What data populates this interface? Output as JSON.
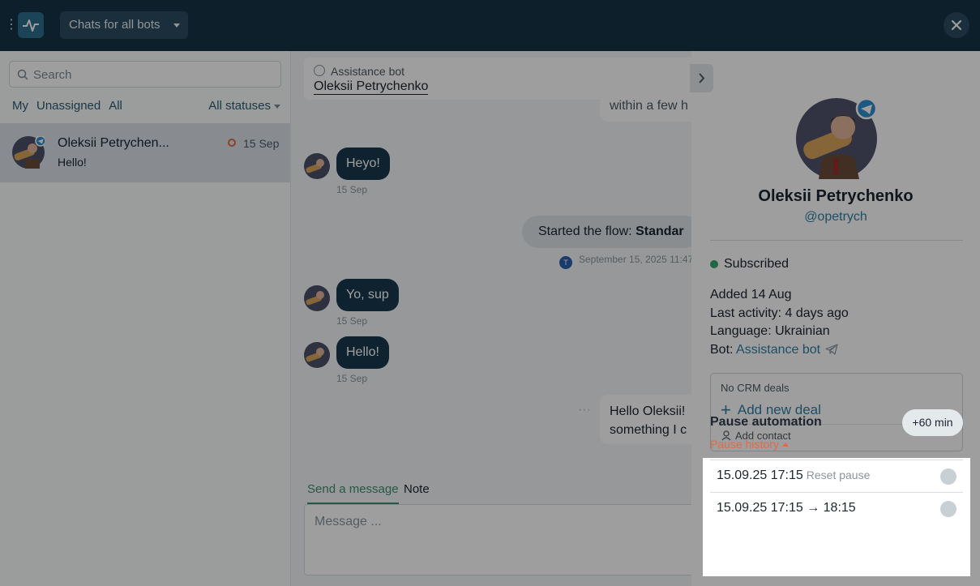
{
  "topbar": {
    "selector_label": "Chats for all bots"
  },
  "left": {
    "search_placeholder": "Search",
    "filters": [
      "My",
      "Unassigned",
      "All"
    ],
    "status_filter": "All statuses",
    "chats": [
      {
        "name": "Oleksii Petrychen...",
        "preview": "Hello!",
        "date": "15 Sep"
      }
    ]
  },
  "center": {
    "header": {
      "bot": "Assistance bot",
      "contact": "Oleksii Petrychenko"
    },
    "partial_text": "within a few h",
    "messages": [
      {
        "text": "Heyo!",
        "date": "15 Sep"
      },
      {
        "text": "Yo, sup",
        "date": "15 Sep"
      },
      {
        "text": "Hello!",
        "date": "15 Sep"
      }
    ],
    "flow": {
      "prefix": "Started the flow: ",
      "name": "Standar",
      "meta": "September 15, 2025 11:47"
    },
    "outgoing": {
      "line1": "Hello Oleksii!",
      "line2": "something I c"
    },
    "tabs": {
      "send": "Send a message",
      "note": "Note"
    },
    "composer_placeholder": "Message ..."
  },
  "profile": {
    "name": "Oleksii Petrychenko",
    "username": "@opetrych",
    "status": "Subscribed",
    "added": "Added 14 Aug",
    "last_activity": "Last activity: 4 days ago",
    "language": "Language: Ukrainian",
    "bot_prefix": "Bot: ",
    "bot_name": "Assistance bot",
    "crm": {
      "none": "No CRM deals",
      "add_deal": "Add new deal",
      "add_contact": "Add contact"
    },
    "pause": {
      "title": "Pause automation",
      "button": "+60 min",
      "history_label": "Pause history",
      "rows": [
        {
          "time": "15.09.25 17:15",
          "extra": "Reset pause"
        },
        {
          "time": "15.09.25 17:15 → 18:15",
          "extra": ""
        }
      ]
    }
  },
  "colors": {
    "topbar": "#153345",
    "accent": "#2f7fa3",
    "bubble": "#18394c",
    "warning": "#e06c44",
    "success": "#3aa36f"
  }
}
